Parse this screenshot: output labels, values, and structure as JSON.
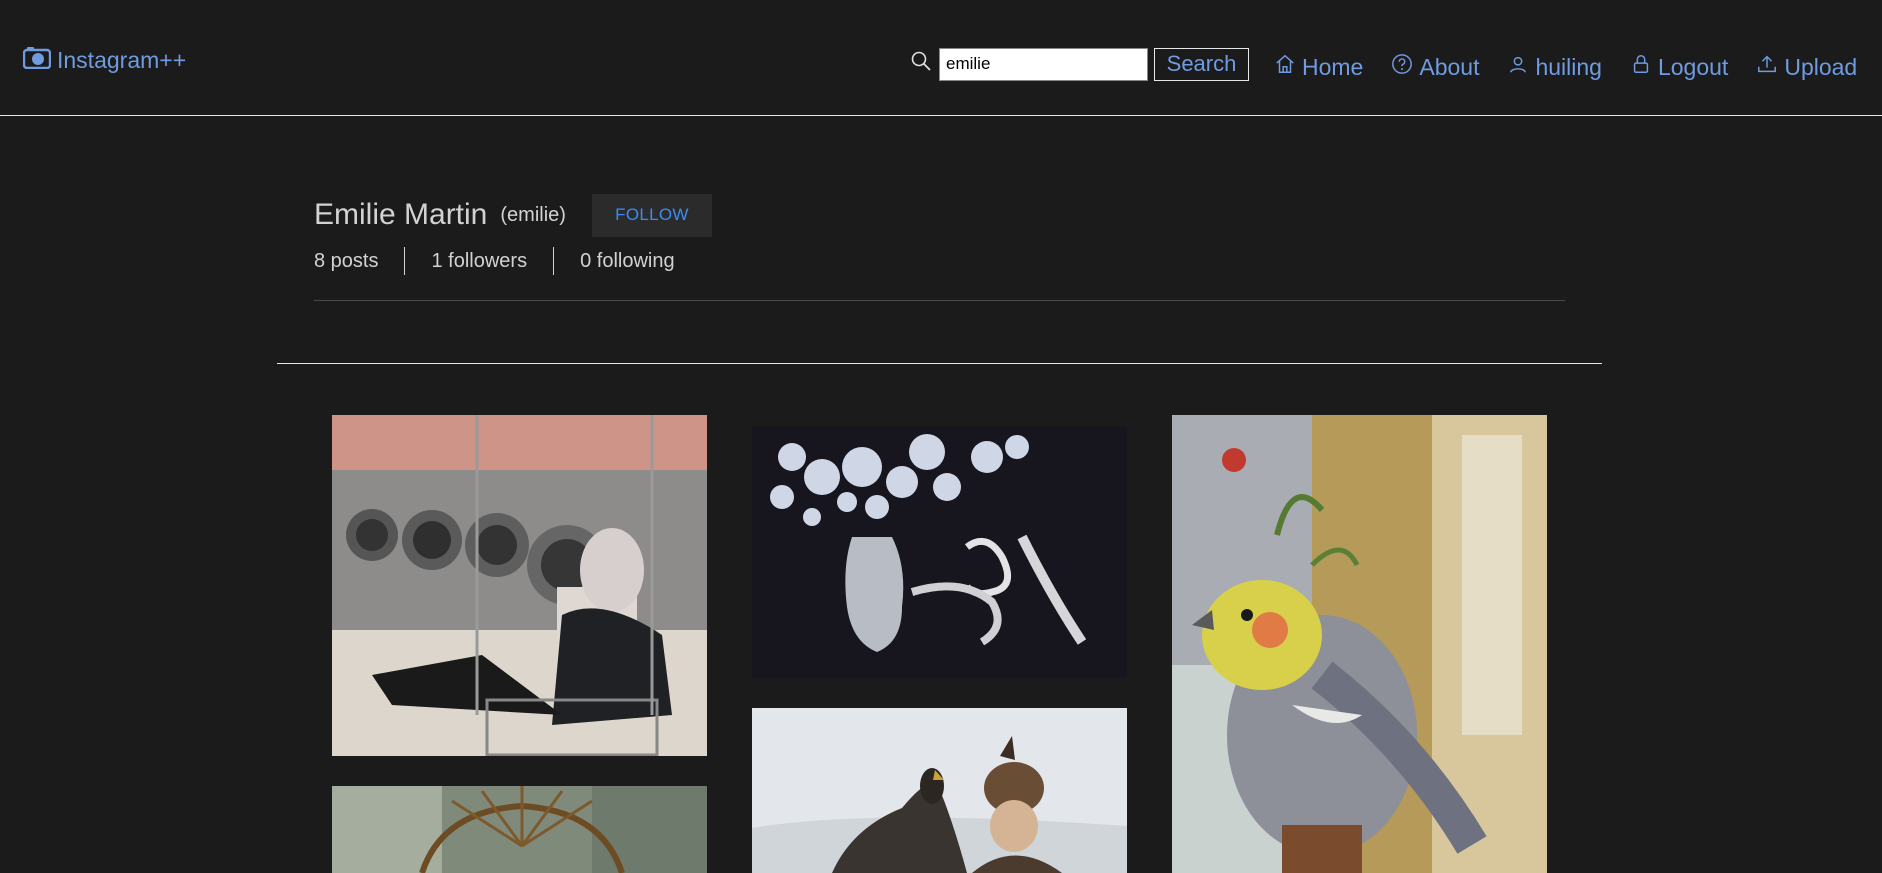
{
  "brand": {
    "name": "Instagram++",
    "icon": "camera-icon"
  },
  "search": {
    "value": "emilie",
    "button_label": "Search",
    "icon": "search-icon"
  },
  "nav": [
    {
      "label": "Home",
      "icon": "home-icon"
    },
    {
      "label": "About",
      "icon": "question-icon"
    },
    {
      "label": "huiling",
      "icon": "user-icon"
    },
    {
      "label": "Logout",
      "icon": "lock-icon"
    },
    {
      "label": "Upload",
      "icon": "upload-icon"
    }
  ],
  "profile": {
    "full_name": "Emilie Martin",
    "username": "(emilie)",
    "follow_label": "FOLLOW",
    "posts": "8 posts",
    "followers": "1 followers",
    "following": "0 following"
  },
  "colors": {
    "background": "#1c1b1c",
    "link": "#6f9be0",
    "follow_text": "#3d8bf2"
  },
  "posts": [
    {
      "subject": "masked figure in laundromat cart"
    },
    {
      "subject": "white flowers in vase with hands"
    },
    {
      "subject": "cockatiel by window"
    },
    {
      "subject": "ornate sun crown"
    },
    {
      "subject": "eagle hunter with bird"
    }
  ]
}
